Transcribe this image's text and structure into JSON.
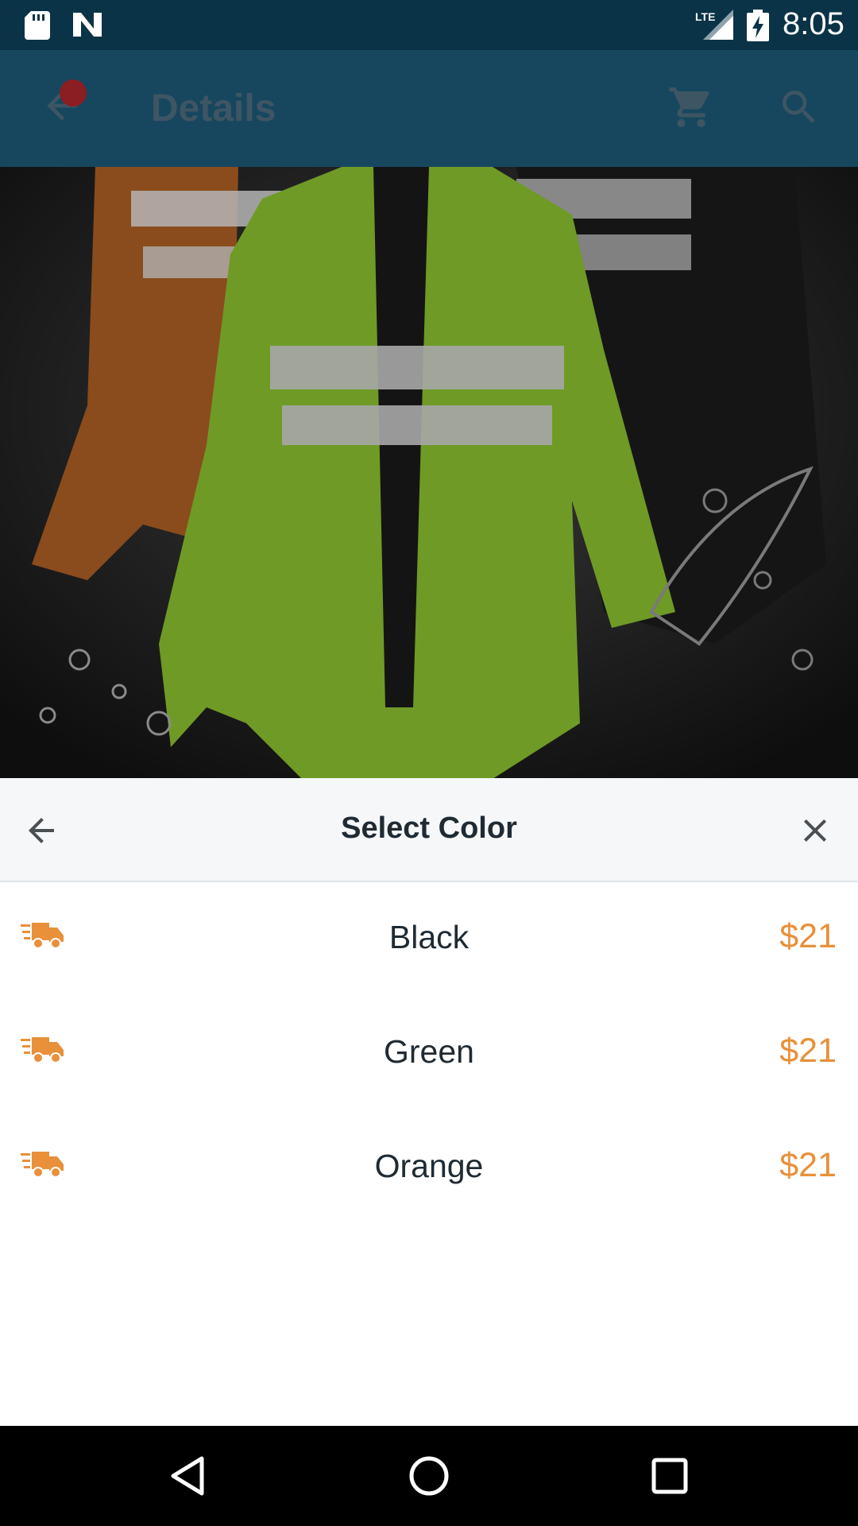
{
  "status_bar": {
    "time": "8:05",
    "network": "LTE",
    "icons": [
      "sd-card-icon",
      "n-notification-icon",
      "lte-signal-icon",
      "battery-charging-icon"
    ]
  },
  "app_bar": {
    "title": "Details",
    "icons": [
      "back-arrow-icon",
      "cart-icon",
      "search-icon"
    ]
  },
  "sheet": {
    "title": "Select Color",
    "options": [
      {
        "label": "Black",
        "price": "$21",
        "icon": "shipping-truck-icon"
      },
      {
        "label": "Green",
        "price": "$21",
        "icon": "shipping-truck-icon"
      },
      {
        "label": "Orange",
        "price": "$21",
        "icon": "shipping-truck-icon"
      }
    ]
  },
  "nav_bar": {
    "icons": [
      "nav-back-icon",
      "nav-home-icon",
      "nav-recents-icon"
    ]
  },
  "colors": {
    "status_bar": "#0b3347",
    "app_bar": "#17475f",
    "accent": "#e8903a",
    "text": "#1f2a33"
  }
}
